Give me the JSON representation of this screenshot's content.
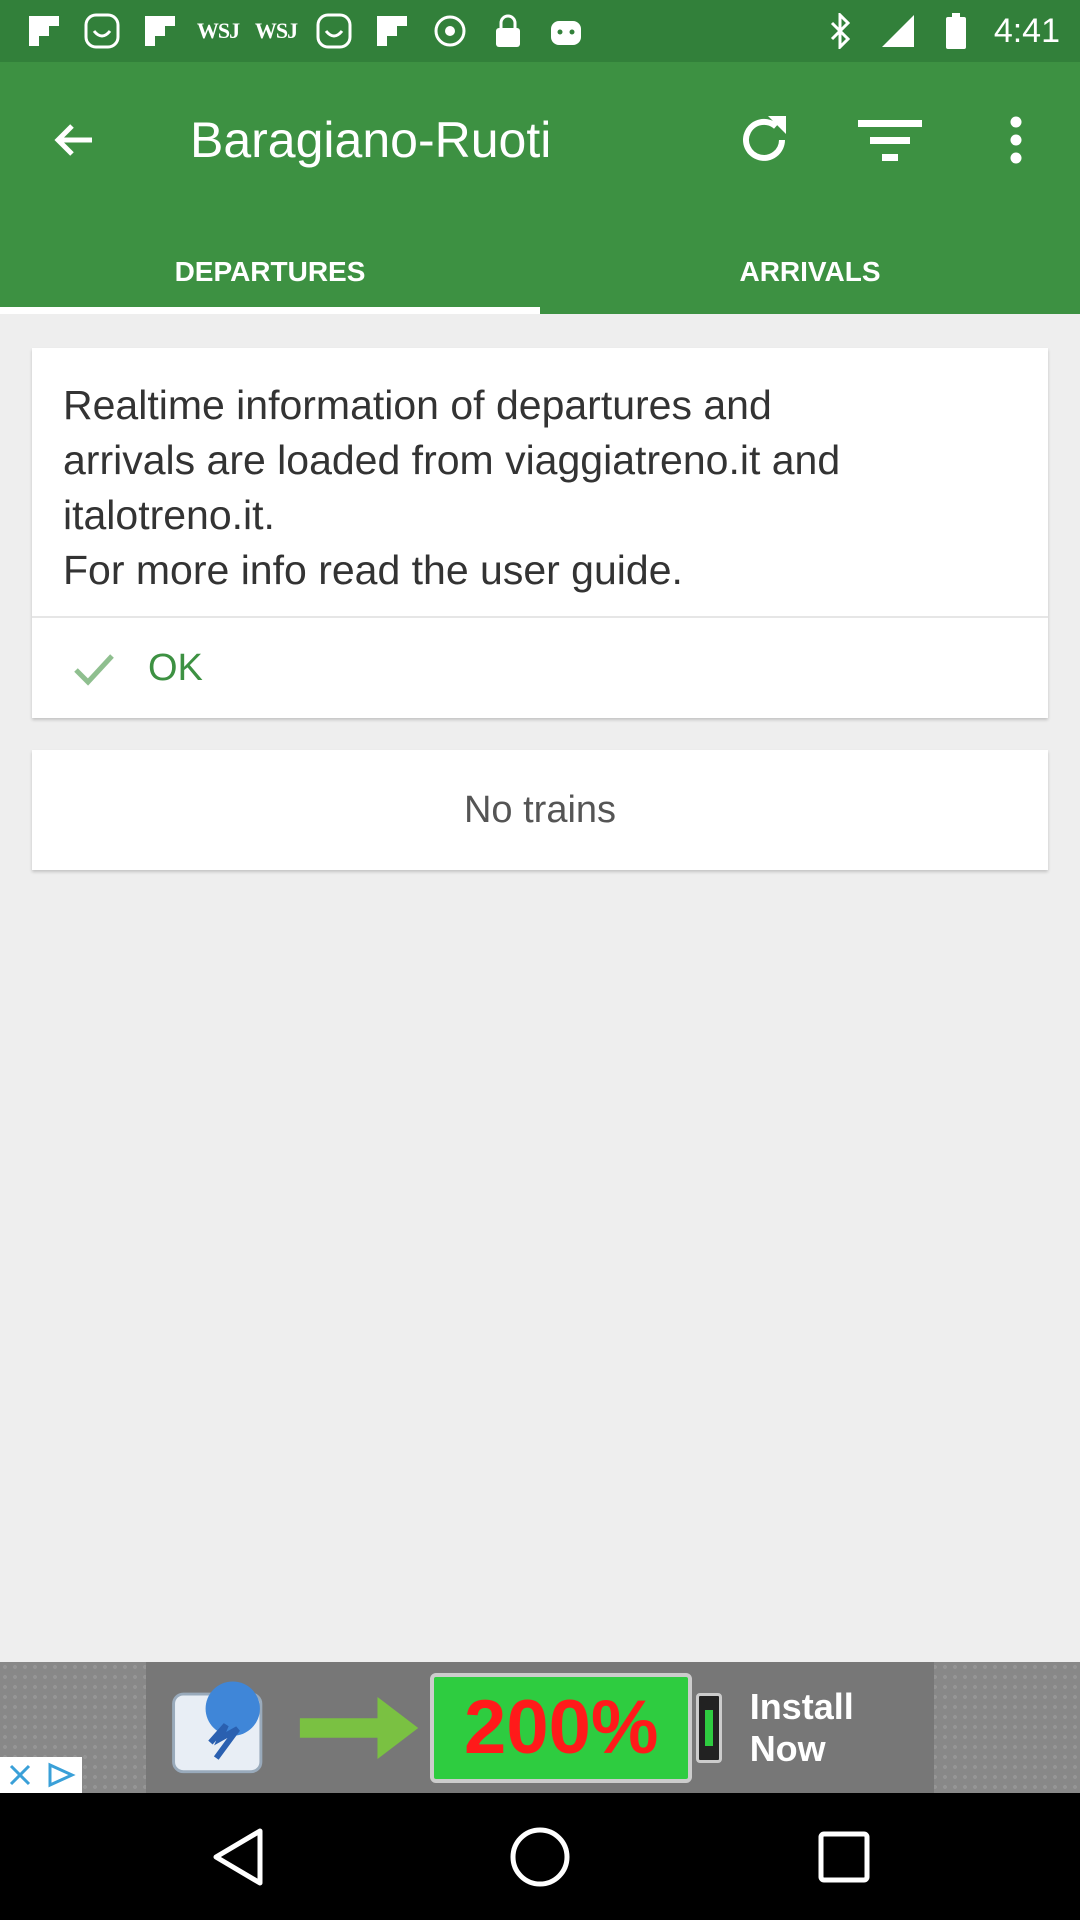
{
  "status_bar": {
    "time": "4:41",
    "left_icons": [
      "flipboard-icon",
      "smiley-icon",
      "flipboard-icon",
      "wsj-icon",
      "wsj-icon",
      "smiley-icon",
      "flipboard-icon",
      "target-icon",
      "lock-icon",
      "android-icon"
    ],
    "wsj_text": "WSJ",
    "right_icons": [
      "bluetooth-icon",
      "signal-icon",
      "battery-icon"
    ]
  },
  "app_bar": {
    "title": "Baragiano-Ruoti",
    "actions": [
      "refresh-icon",
      "filter-icon",
      "more-vert-icon"
    ]
  },
  "tabs": [
    {
      "label": "DEPARTURES",
      "selected": true
    },
    {
      "label": "ARRIVALS",
      "selected": false
    }
  ],
  "info_card": {
    "lines": [
      "Realtime information of departures and",
      "arrivals are loaded from viaggiatreno.it and",
      "italotreno.it.",
      "For more info read the user guide."
    ],
    "ok_label": "OK"
  },
  "no_trains_text": "No trains",
  "ad": {
    "percent": "200%",
    "cta": "Install Now"
  },
  "colors": {
    "status_bar": "#32803a",
    "app_bar": "#3d9142",
    "accent": "#3d9142"
  }
}
